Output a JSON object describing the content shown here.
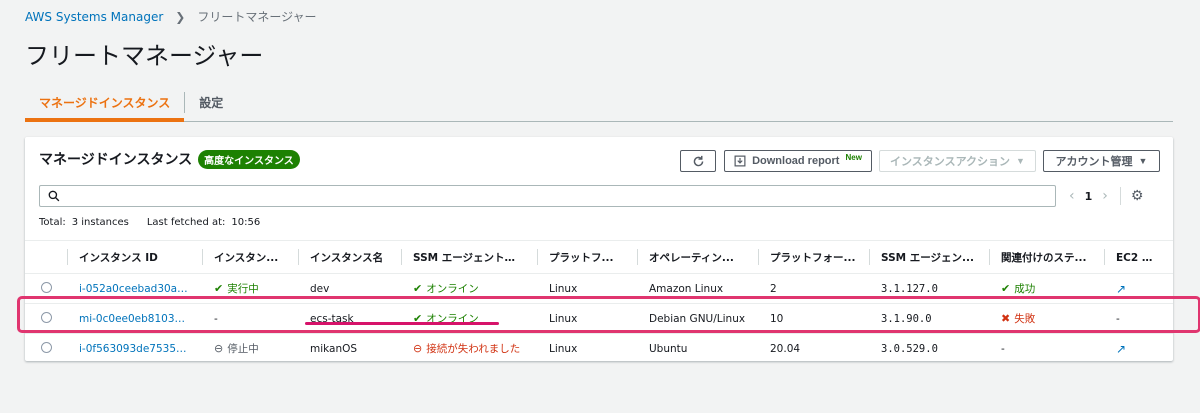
{
  "breadcrumb": {
    "root": "AWS Systems Manager",
    "current": "フリートマネージャー"
  },
  "page_title": "フリートマネージャー",
  "tabs": [
    {
      "label": "マネージドインスタンス",
      "active": true
    },
    {
      "label": "設定",
      "active": false
    }
  ],
  "panel": {
    "title": "マネージドインスタンス",
    "badge": "高度なインスタンス",
    "buttons": {
      "download": "Download report",
      "download_new": "New",
      "instance_action": "インスタンスアクション",
      "account_mgmt": "アカウント管理"
    },
    "search_placeholder": "",
    "pager": {
      "page": "1"
    },
    "meta": {
      "total_label": "Total:",
      "total_value": "3 instances",
      "fetched_label": "Last fetched at:",
      "fetched_value": "10:56"
    }
  },
  "table": {
    "headers": [
      "インスタンス ID",
      "インスタン...",
      "インスタンス名",
      "SSM エージェントの ...",
      "プラットフ...",
      "オペレーティン...",
      "プラットフォー...",
      "SSM エージェン...",
      "関連付けのステ...",
      "EC2 インス..."
    ],
    "rows": [
      {
        "id": "i-052a0ceebad30abd7",
        "state": "実行中",
        "name": "dev",
        "ssm": "オンライン",
        "platform": "Linux",
        "os": "Amazon Linux",
        "version": "2",
        "agent": "3.1.127.0",
        "assoc": "成功",
        "ec2": ""
      },
      {
        "id": "mi-0c0ee0eb81032e...",
        "state": "-",
        "name": "ecs-task",
        "ssm": "オンライン",
        "platform": "Linux",
        "os": "Debian GNU/Linux",
        "version": "10",
        "agent": "3.1.90.0",
        "assoc": "失敗",
        "ec2": "-"
      },
      {
        "id": "i-0f563093de753571e",
        "state": "停止中",
        "name": "mikanOS",
        "ssm": "接続が失われました",
        "platform": "Linux",
        "os": "Ubuntu",
        "version": "20.04",
        "agent": "3.0.529.0",
        "assoc": "-",
        "ec2": ""
      }
    ]
  },
  "colors": {
    "accent": "#ec7211",
    "link": "#0073bb",
    "success": "#1d8102",
    "error": "#d13212",
    "highlight": "#e0356f"
  },
  "icons": [
    "chevron-right-icon",
    "refresh-icon",
    "download-icon",
    "caret-down-icon",
    "search-icon",
    "chevron-left-icon",
    "settings-gear-icon",
    "check-circle-icon",
    "minus-circle-icon",
    "x-circle-icon",
    "external-link-icon"
  ]
}
